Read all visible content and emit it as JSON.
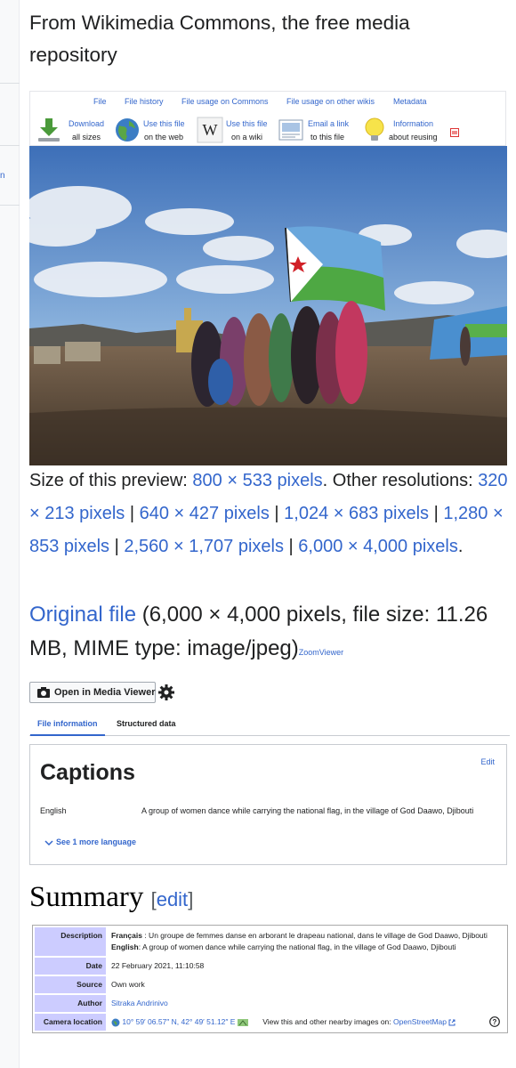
{
  "page": {
    "subtitle": "From Wikimedia Commons, the free media repository"
  },
  "file_tabs": [
    "File",
    "File history",
    "File usage on Commons",
    "File usage on other wikis",
    "Metadata"
  ],
  "tools": [
    {
      "line1": "Download",
      "line2": "all sizes",
      "icon": "download-icon"
    },
    {
      "line1": "Use this file",
      "line2": "on the web",
      "icon": "globe-icon"
    },
    {
      "line1": "Use this file",
      "line2": "on a wiki",
      "icon": "wikipedia-icon"
    },
    {
      "line1": "Email a link",
      "line2": "to this file",
      "icon": "email-icon"
    },
    {
      "line1": "Information",
      "line2": "about reusing",
      "icon": "lightbulb-icon"
    }
  ],
  "resolutions": {
    "preview_prefix": "Size of this preview: ",
    "preview_size": "800 × 533 pixels",
    "other_prefix": ". Other resolutions: ",
    "items": [
      "320 × 213 pixels",
      "640 × 427 pixels",
      "1,024 × 683 pixels",
      "1,280 × 853 pixels",
      "2,560 × 1,707 pixels",
      "6,000 × 4,000 pixels"
    ],
    "separator": " | ",
    "end": "."
  },
  "original": {
    "link": "Original file",
    "details": " (6,000 × 4,000 pixels, file size: 11.26 MB, MIME type: image/jpeg)",
    "zoom": "ZoomViewer"
  },
  "media_viewer_button": "Open in Media Viewer",
  "info_tabs": [
    "File information",
    "Structured data"
  ],
  "captions": {
    "title": "Captions",
    "edit": "Edit",
    "language": "English",
    "text": "A group of women dance while carrying the national flag, in the village of God Daawo, Djibouti",
    "more": "See 1 more language"
  },
  "summary": {
    "heading": "Summary",
    "edit": "edit",
    "rows": {
      "description_label": "Description",
      "fr_lang": "Français",
      "fr_text": " : Un groupe de femmes danse en arborant le drapeau national, dans le village de God Daawo, Djibouti",
      "en_lang": "English",
      "en_text": ": A group of women dance while carrying the national flag, in the village of God Daawo, Djibouti",
      "date_label": "Date",
      "date": "22 February 2021, 11:10:58",
      "source_label": "Source",
      "source": "Own work",
      "author_label": "Author",
      "author": "Sitraka Andrinivo",
      "camera_label": "Camera location",
      "coords": "10° 59′ 06.57″ N, 42° 49′ 51.12″ E",
      "osm_prefix": "View this and other nearby images on: ",
      "osm_link": "OpenStreetMap"
    }
  },
  "sidebar": {
    "fragment": "n"
  },
  "colors": {
    "link": "#3366cc",
    "text": "#202122",
    "infobox_label": "#ccccff",
    "tab_active": "#3366cc"
  }
}
